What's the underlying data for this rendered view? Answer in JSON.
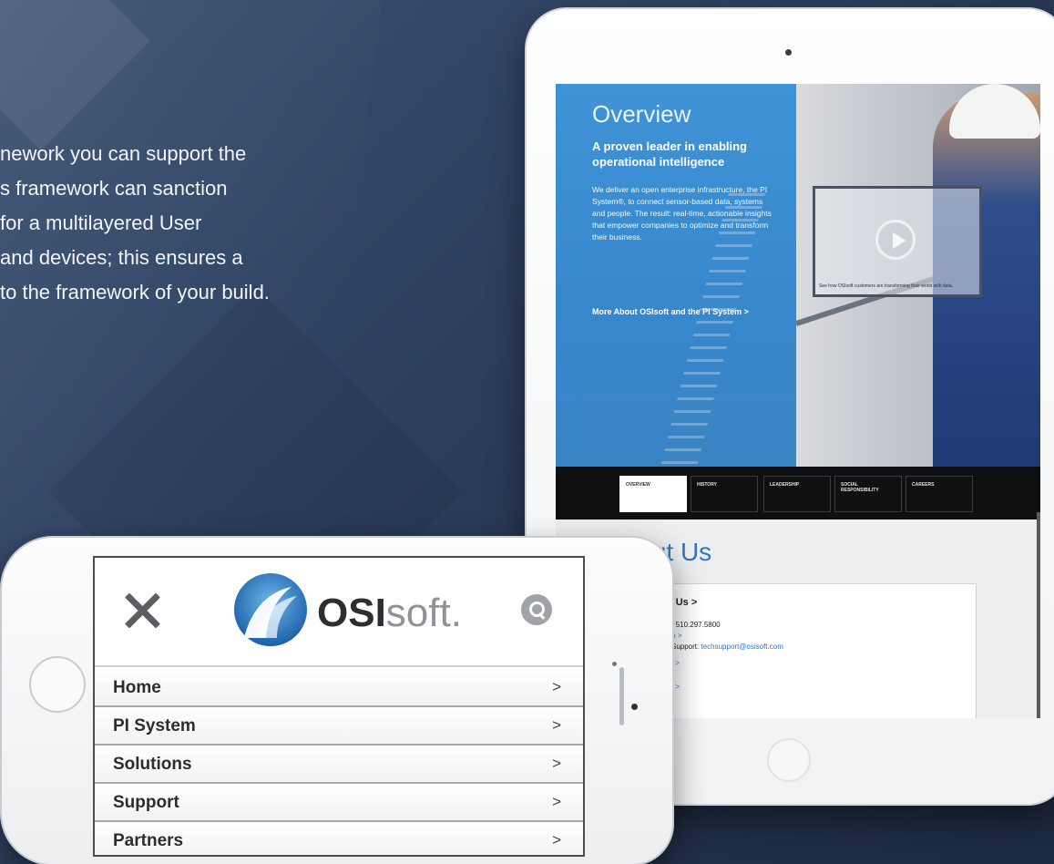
{
  "intro": {
    "lines": [
      "nework you can support the",
      "s framework can sanction",
      " for a multilayered User",
      " and devices; this ensures a",
      "to the framework of your build."
    ]
  },
  "tablet": {
    "overview": {
      "title": "Overview",
      "subtitle": "A proven leader in enabling operational intelligence",
      "body": "We deliver an open enterprise infrastructure, the PI System®, to connect sensor-based data, systems and people. The result: real-time, actionable insights that empower companies to optimize and transform their business.",
      "link": "More About OSIsoft and the PI System >",
      "video_caption": "See how OSIsoft customers are transforming their world with data."
    },
    "tabs": [
      "OVERVIEW",
      "HISTORY",
      "LEADERSHIP",
      "SOCIAL RESPONSIBILITY",
      "CAREERS"
    ],
    "about": {
      "title": "About Us",
      "contact_heading": "t Us >",
      "phone": "1 510.297.5800",
      "email_link": "m >",
      "support_label": "Support:",
      "support_email": "techsupport@osisoft.com",
      "link1": "s >",
      "link2": "s >"
    }
  },
  "phone": {
    "logo_bold": "OSI",
    "logo_light": "soft.",
    "menu": [
      {
        "label": "Home",
        "arrow": ">"
      },
      {
        "label": "PI System",
        "arrow": ">"
      },
      {
        "label": "Solutions",
        "arrow": ">"
      },
      {
        "label": "Support",
        "arrow": ">"
      },
      {
        "label": "Partners",
        "arrow": ">"
      }
    ]
  },
  "colors": {
    "accent_blue": "#2d76c5",
    "overview_panel": "#3a8bcf",
    "background": "#2a3a55"
  }
}
